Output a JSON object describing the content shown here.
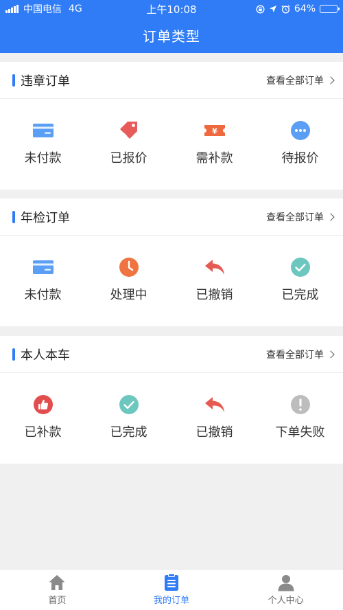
{
  "status_bar": {
    "carrier": "中国电信",
    "network": "4G",
    "time": "上午10:08",
    "battery": "64%",
    "battery_level": 0.64
  },
  "header": {
    "title": "订单类型"
  },
  "sections": [
    {
      "title": "违章订单",
      "view_all": "查看全部订单",
      "items": [
        {
          "label": "未付款",
          "icon": "card-icon"
        },
        {
          "label": "已报价",
          "icon": "price-tag-icon"
        },
        {
          "label": "需补款",
          "icon": "yen-ticket-icon"
        },
        {
          "label": "待报价",
          "icon": "more-dots-icon"
        }
      ]
    },
    {
      "title": "年检订单",
      "view_all": "查看全部订单",
      "items": [
        {
          "label": "未付款",
          "icon": "card-icon"
        },
        {
          "label": "处理中",
          "icon": "clock-icon"
        },
        {
          "label": "已撤销",
          "icon": "undo-arrow-icon"
        },
        {
          "label": "已完成",
          "icon": "check-circle-icon"
        }
      ]
    },
    {
      "title": "本人本车",
      "view_all": "查看全部订单",
      "items": [
        {
          "label": "已补款",
          "icon": "thumbs-up-icon"
        },
        {
          "label": "已完成",
          "icon": "check-circle-icon"
        },
        {
          "label": "已撤销",
          "icon": "undo-arrow-icon"
        },
        {
          "label": "下单失败",
          "icon": "exclamation-circle-icon"
        }
      ]
    }
  ],
  "tabbar": {
    "items": [
      {
        "label": "首页",
        "icon": "home-icon",
        "active": false
      },
      {
        "label": "我的订单",
        "icon": "clipboard-list-icon",
        "active": true
      },
      {
        "label": "个人中心",
        "icon": "user-icon",
        "active": false
      }
    ]
  },
  "colors": {
    "primary": "#2f7cf6",
    "card_blue": "#5a9ef5",
    "tag_red": "#e85b5b",
    "ticket_orange": "#ee6a3e",
    "clock_orange": "#f07441",
    "undo_red": "#e55a52",
    "check_teal": "#6cc7be",
    "thumb_red": "#e24d4d",
    "fail_gray": "#bdbdbd",
    "tab_gray": "#8a8a8a"
  }
}
